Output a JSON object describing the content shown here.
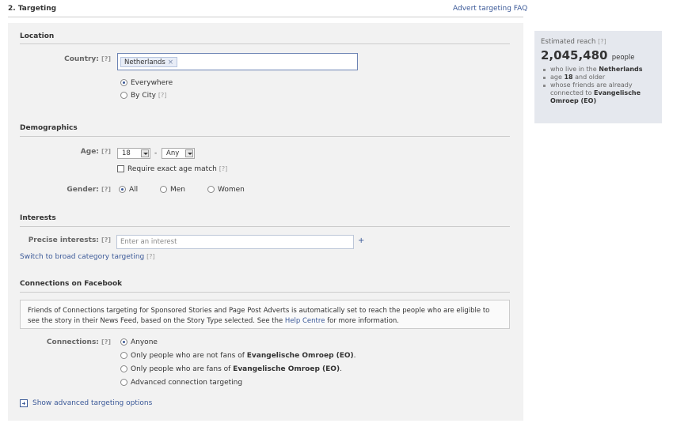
{
  "header": {
    "title": "2. Targeting",
    "faq_link": "Advert targeting FAQ"
  },
  "help_marker": "[?]",
  "location": {
    "section_title": "Location",
    "country_label": "Country:",
    "country_token": "Netherlands",
    "token_remove": "×",
    "options": [
      "Everywhere",
      "By City"
    ],
    "selected": "Everywhere"
  },
  "demographics": {
    "section_title": "Demographics",
    "age_label": "Age:",
    "age_min": "18",
    "age_separator": "-",
    "age_max": "Any",
    "exact_age_label": "Require exact age match",
    "gender_label": "Gender:",
    "gender_options": [
      "All",
      "Men",
      "Women"
    ],
    "gender_selected": "All"
  },
  "interests": {
    "section_title": "Interests",
    "precise_label": "Precise interests:",
    "placeholder": "Enter an interest",
    "add": "+",
    "broad_link": "Switch to broad category targeting"
  },
  "connections": {
    "section_title": "Connections on Facebook",
    "notice_before": "Friends of Connections targeting for Sponsored Stories and Page Post Adverts is automatically set to reach the people who are eligible to see the story in their News Feed, based on the Story Type selected. See the ",
    "notice_link": "Help Centre",
    "notice_after": " for more information.",
    "label": "Connections:",
    "options": {
      "anyone": "Anyone",
      "not_fans_prefix": "Only people who are not fans of ",
      "fans_prefix": "Only people who are fans of ",
      "page_name": "Evangelische Omroep (EO)",
      "suffix": ".",
      "advanced": "Advanced connection targeting"
    },
    "selected": "Anyone"
  },
  "advanced_link": "Show advanced targeting options",
  "reach": {
    "title": "Estimated reach",
    "count": "2,045,480",
    "unit": "people",
    "items": {
      "live_prefix": "who live in the ",
      "live_value": "Netherlands",
      "age_prefix": "age ",
      "age_value": "18",
      "age_suffix": " and older",
      "friends_prefix": "whose friends are already connected to ",
      "friends_value": "Evangelische Omroep (EO)"
    }
  }
}
